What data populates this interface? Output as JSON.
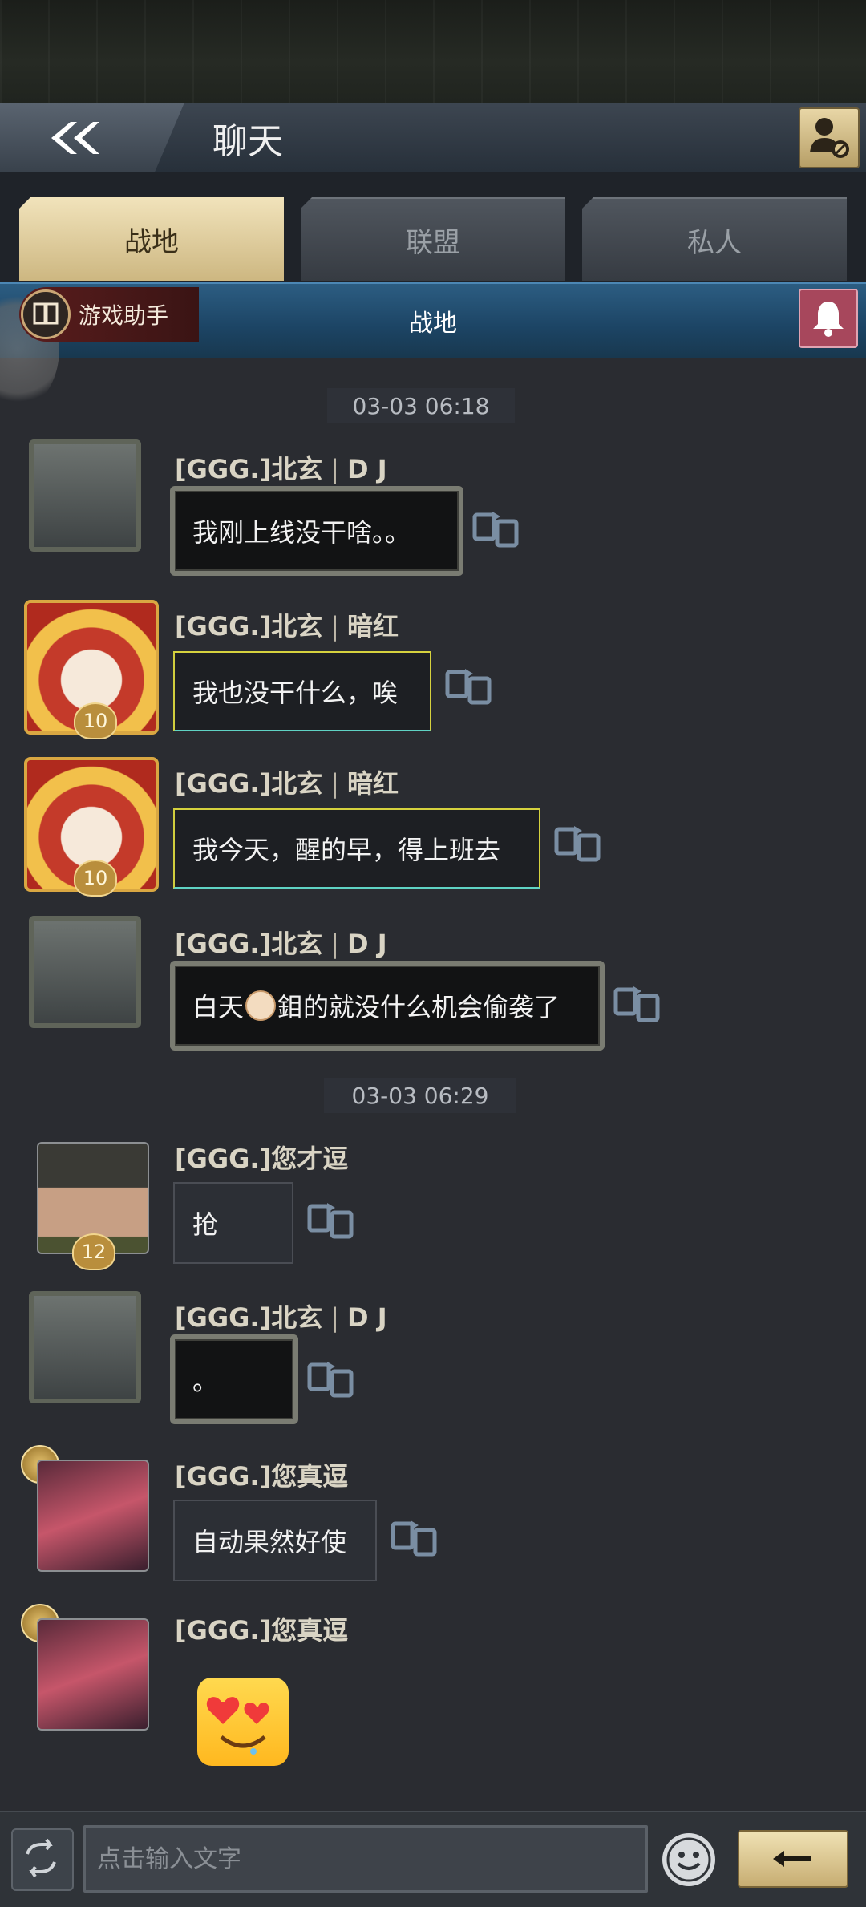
{
  "header": {
    "title": "聊天"
  },
  "tabs": [
    {
      "label": "战地",
      "active": true
    },
    {
      "label": "联盟",
      "active": false
    },
    {
      "label": "私人",
      "active": false
    }
  ],
  "channel_strip": {
    "helper_label": "游戏助手",
    "title": "战地"
  },
  "messages": [
    {
      "type": "time",
      "text": "03-03 06:18"
    },
    {
      "type": "msg",
      "sender_tag": "[GGG.]",
      "sender_name": "北玄",
      "sender_suffix": "D J",
      "text": "我刚上线没干啥。。",
      "avatar": "soldier"
    },
    {
      "type": "msg",
      "sender_tag": "[GGG.]",
      "sender_name": "北玄",
      "sender_suffix": "暗红",
      "text": "我也没干什么，唉",
      "avatar": "festive",
      "level": "10"
    },
    {
      "type": "msg",
      "sender_tag": "[GGG.]",
      "sender_name": "北玄",
      "sender_suffix": "暗红",
      "text": "我今天，醒的早，得上班去",
      "avatar": "festive",
      "level": "10"
    },
    {
      "type": "msg",
      "sender_tag": "[GGG.]",
      "sender_name": "北玄",
      "sender_suffix": "D J",
      "text_before": "白天",
      "text_after": "鉬的就没什么机会偷袭了",
      "avatar": "soldier"
    },
    {
      "type": "time",
      "text": "03-03 06:29"
    },
    {
      "type": "msg",
      "sender_tag": "[GGG.]",
      "sender_name": "您才逗",
      "text": "抢",
      "avatar": "officer",
      "level": "12"
    },
    {
      "type": "msg",
      "sender_tag": "[GGG.]",
      "sender_name": "北玄",
      "sender_suffix": "D J",
      "text": "。",
      "avatar": "soldier"
    },
    {
      "type": "msg",
      "sender_tag": "[GGG.]",
      "sender_name": "您真逗",
      "text": "自动果然好使",
      "avatar": "woman"
    },
    {
      "type": "msg",
      "sender_tag": "[GGG.]",
      "sender_name": "您真逗",
      "sticker": "heart-eyes-sticker",
      "avatar": "woman"
    }
  ],
  "separator": "|",
  "input": {
    "placeholder": "点击输入文字"
  },
  "colors": {
    "accent_gold": "#cdb781",
    "channel_blue": "#1c4464",
    "bubble_gold_border": "#d6d23e"
  }
}
